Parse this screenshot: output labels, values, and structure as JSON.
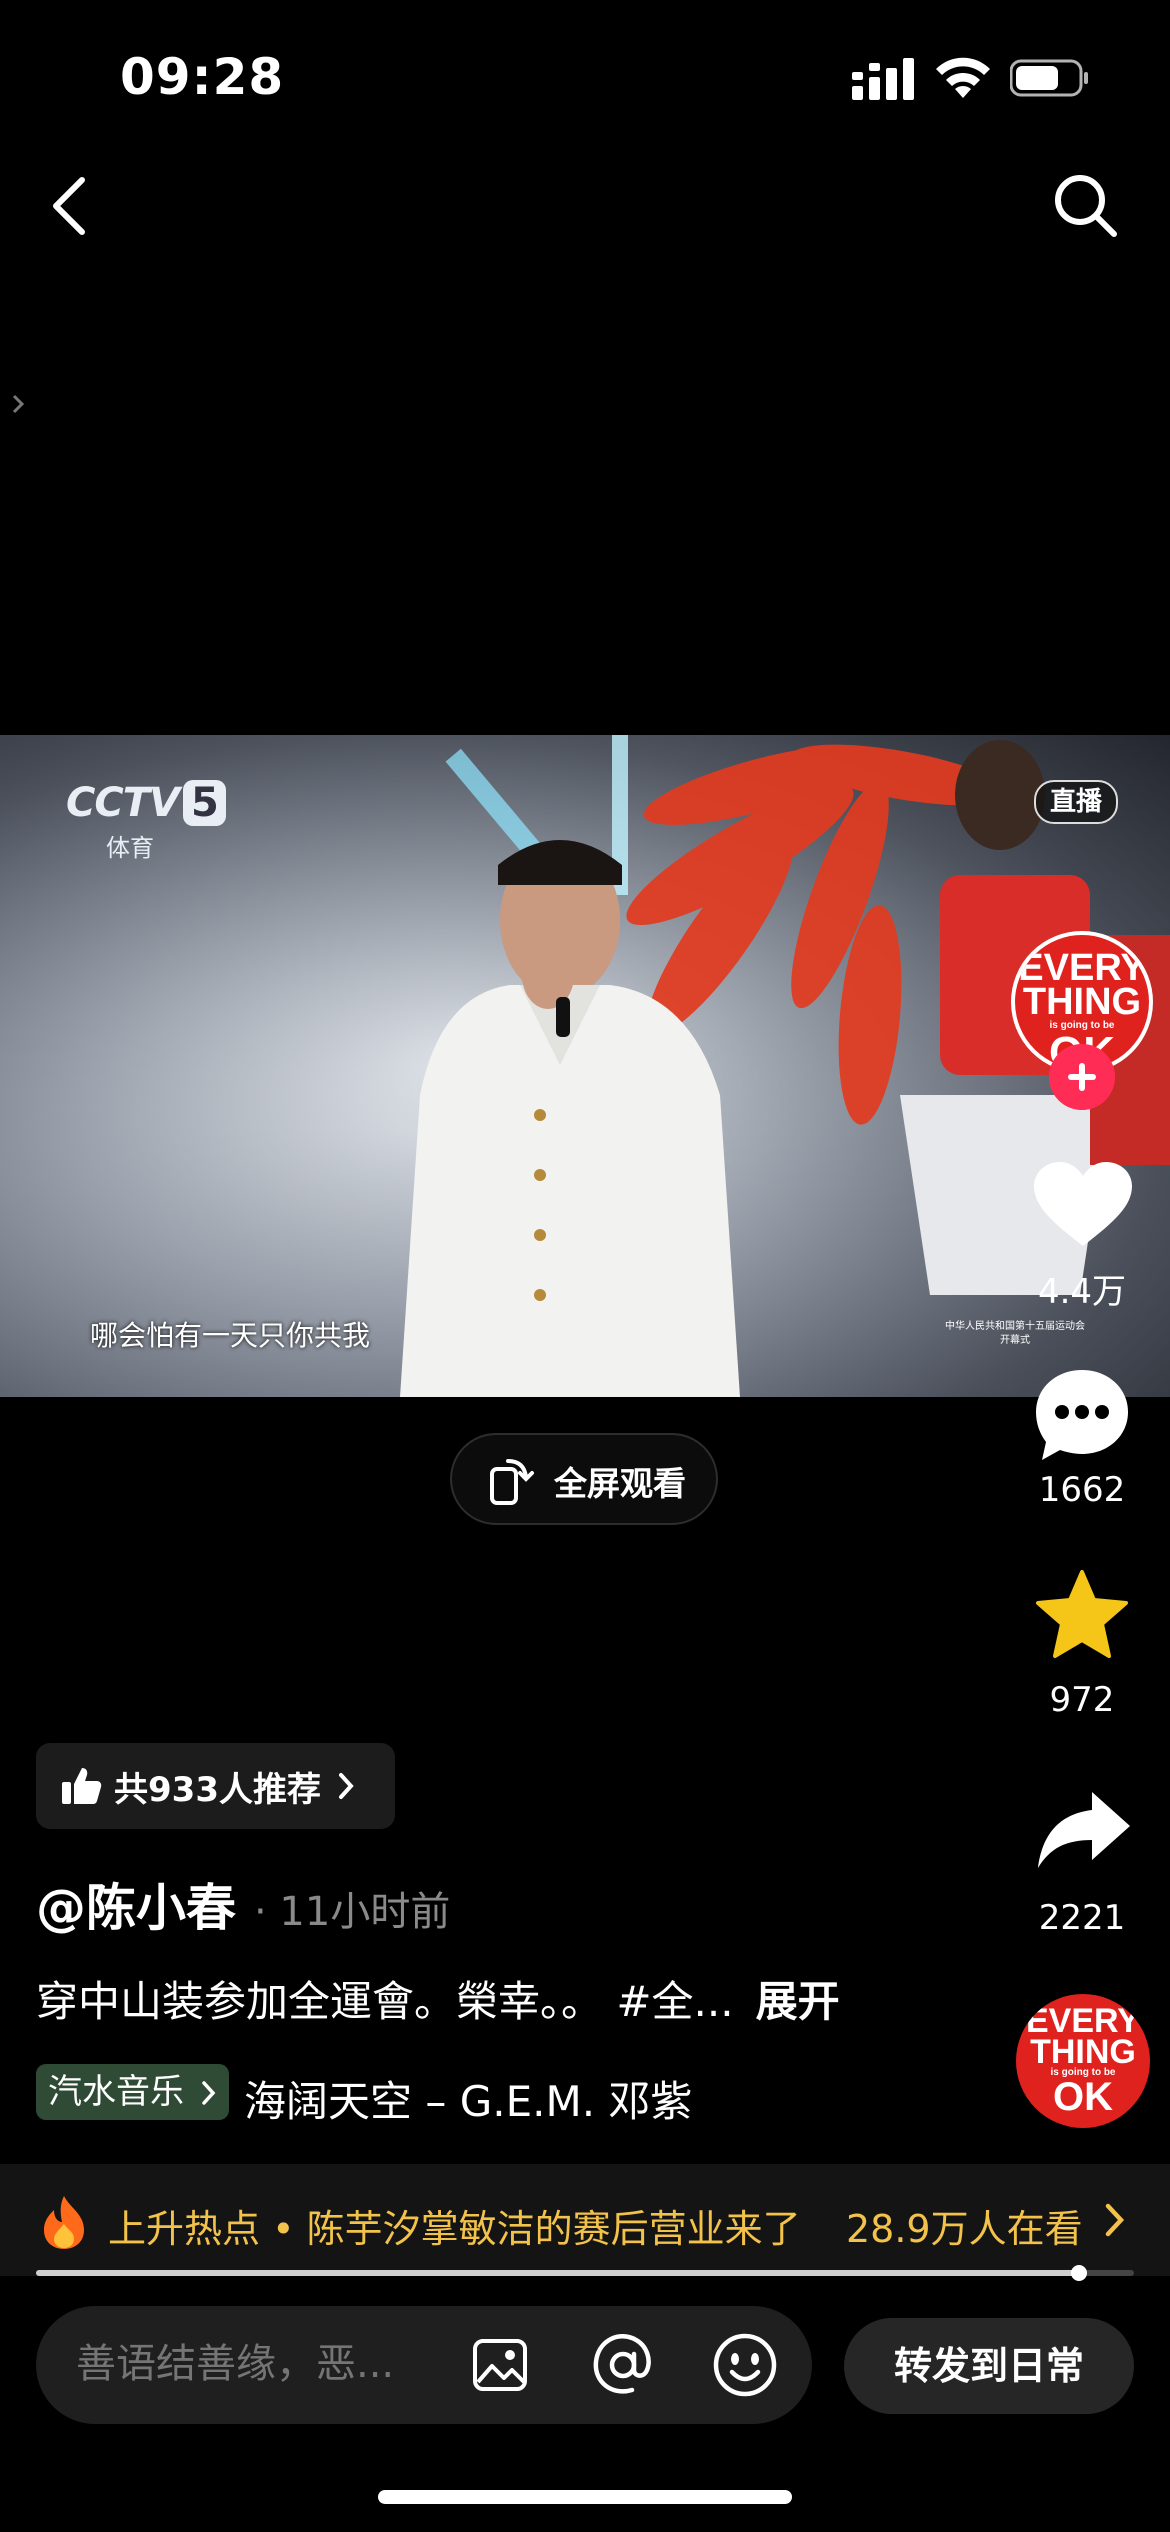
{
  "status_bar": {
    "time": "09:28"
  },
  "video": {
    "channel_logo": "CCTV",
    "channel_number": "5",
    "channel_sub": "体育",
    "live_badge": "直播",
    "subtitle": "哪会怕有一天只你共我",
    "event_mark_line1": "中华人民共和国第十五届运动会",
    "event_mark_line2": "开幕式",
    "event_logo_lines": [
      "EVERY",
      "THING",
      "is going to be",
      "OK"
    ]
  },
  "fullscreen_label": "全屏观看",
  "actions": {
    "like_count": "4.4万",
    "comment_count": "1662",
    "favorite_count": "972",
    "share_count": "2221"
  },
  "recommend_label": "共933人推荐",
  "author": "@陈小春",
  "post_time": "· 11小时前",
  "caption": "穿中山装参加全運會。榮幸。。 #全...",
  "expand_label": "展开",
  "music": {
    "tag": "汽水音乐",
    "name": "海阔天空 – G.E.M. 邓紫"
  },
  "hot": {
    "text": "上升热点 • 陈芋汐掌敏洁的赛后营业来了",
    "viewers": "28.9万人在看"
  },
  "progress": 0.95,
  "comment_placeholder": "善语结善缘，恶...",
  "repost_label": "转发到日常",
  "icons": [
    "back-icon",
    "search-icon",
    "like-icon",
    "comment-icon",
    "star-icon",
    "share-icon",
    "image-icon",
    "at-icon",
    "emoji-icon",
    "fire-icon"
  ],
  "colors": {
    "accent_pink": "#ff2d55",
    "star_yellow": "#f5c518",
    "hot_yellow": "#f2c24b",
    "music_tag_bg": "#2f4b35"
  }
}
